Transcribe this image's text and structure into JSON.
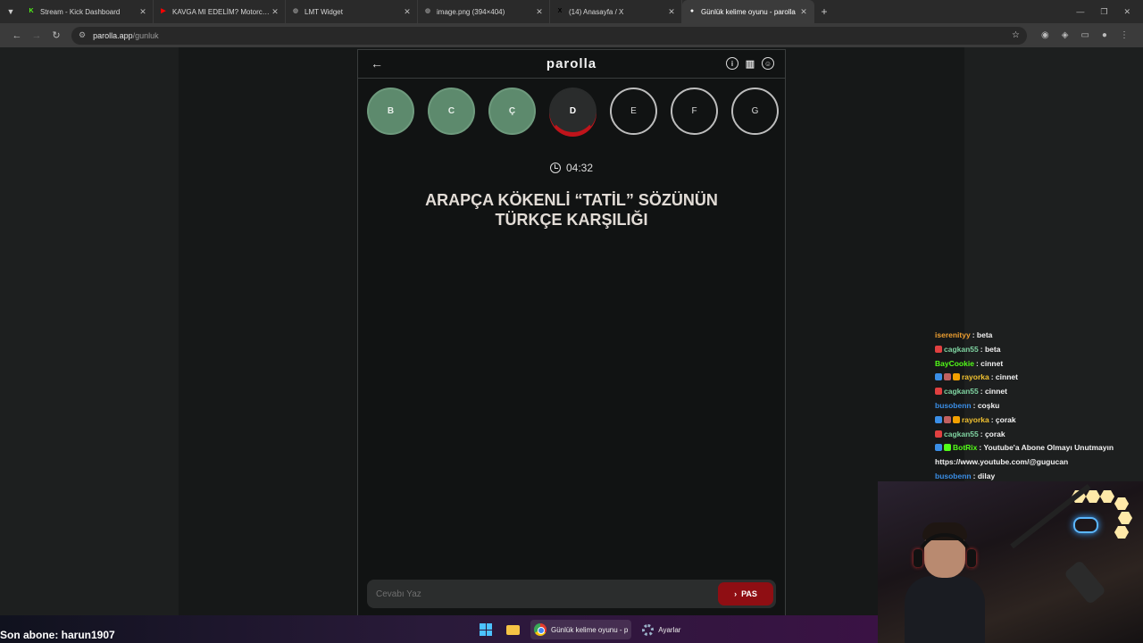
{
  "browser": {
    "tabs": [
      {
        "label": "Stream - Kick Dashboard",
        "favicon": "kick-icon",
        "color": "#53fc18",
        "glyph": "K"
      },
      {
        "label": "KAVGA MI EDELİM? Motorcu G",
        "favicon": "youtube-icon",
        "color": "#ff0000",
        "glyph": "▶"
      },
      {
        "label": "LMT Widget",
        "favicon": "globe-icon",
        "color": "#888888",
        "glyph": "◍"
      },
      {
        "label": "image.png (394×404)",
        "favicon": "globe-icon",
        "color": "#888888",
        "glyph": "◍"
      },
      {
        "label": "(14) Anasayfa / X",
        "favicon": "x-icon",
        "color": "#000000",
        "glyph": "X"
      },
      {
        "label": "Günlük kelime oyunu - parolla",
        "favicon": "parolla-icon",
        "color": "#ffffff",
        "glyph": "●"
      }
    ],
    "url_host": "parolla.app",
    "url_path": "/gunluk"
  },
  "app": {
    "logo": "parolla",
    "letters": [
      {
        "char": "B",
        "state": "correct"
      },
      {
        "char": "C",
        "state": "correct"
      },
      {
        "char": "Ç",
        "state": "correct"
      },
      {
        "char": "D",
        "state": "current"
      },
      {
        "char": "E",
        "state": "pending"
      },
      {
        "char": "F",
        "state": "pending"
      },
      {
        "char": "G",
        "state": "pending"
      }
    ],
    "timer": "04:32",
    "question": "ARAPÇA KÖKENLİ “TATİL” SÖZÜNÜN TÜRKÇE KARŞILIĞI",
    "answer_placeholder": "Cevabı Yaz",
    "pass_label": "PAS",
    "colors": {
      "correct": "#5d8a6d",
      "current_ring": "#c0141b",
      "pass_button": "#8f0e13"
    }
  },
  "chat": [
    {
      "user": "iserenityy",
      "color": "#f0a030",
      "badges": [],
      "message": "beta"
    },
    {
      "user": "cagkan55",
      "color": "#7ed2a0",
      "badges": [
        "#e04040"
      ],
      "message": "beta"
    },
    {
      "user": "BayCookie",
      "color": "#53fc18",
      "badges": [],
      "message": "cinnet"
    },
    {
      "user": "rayorka",
      "color": "#f2c230",
      "badges": [
        "#3a8ee6",
        "#c06060",
        "#f2a000"
      ],
      "message": "cinnet"
    },
    {
      "user": "cagkan55",
      "color": "#7ed2a0",
      "badges": [
        "#e04040"
      ],
      "message": "cinnet"
    },
    {
      "user": "busobenn",
      "color": "#3a8ee6",
      "badges": [],
      "message": "coşku"
    },
    {
      "user": "rayorka",
      "color": "#f2c230",
      "badges": [
        "#3a8ee6",
        "#c06060",
        "#f2a000"
      ],
      "message": "çorak"
    },
    {
      "user": "cagkan55",
      "color": "#7ed2a0",
      "badges": [
        "#e04040"
      ],
      "message": "çorak"
    },
    {
      "user": "BotRix",
      "color": "#53fc18",
      "badges": [
        "#3a8ee6",
        "#53fc18"
      ],
      "message": "Youtube'a Abone Olmayı Unutmayın"
    },
    {
      "user": "",
      "color": "#ffffff",
      "badges": [],
      "message": "https://www.youtube.com/@gugucan"
    },
    {
      "user": "busobenn",
      "color": "#3a8ee6",
      "badges": [],
      "message": "dilay"
    }
  ],
  "overlay": {
    "last_sub": "Son abone: harun1907"
  },
  "taskbar": {
    "chrome_label": "Günlük kelime oyunu - p",
    "settings_label": "Ayarlar"
  }
}
